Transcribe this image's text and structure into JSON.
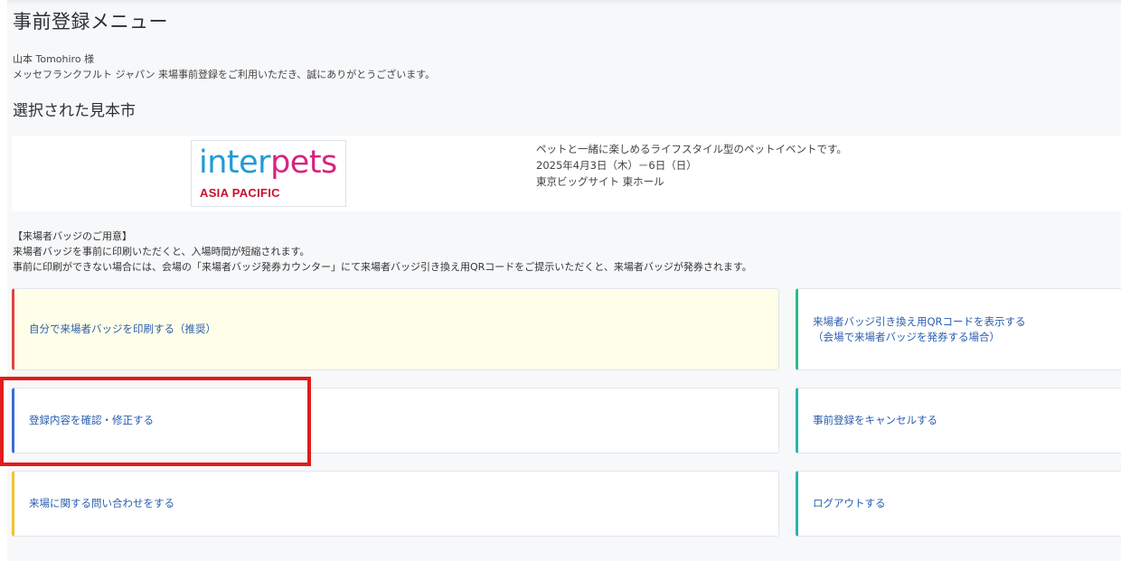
{
  "header": {
    "title": "事前登録メニュー"
  },
  "greeting": {
    "user_line": "山本 Tomohiro 様",
    "message": "メッセフランクフルト ジャパン 来場事前登録をご利用いただき、誠にありがとうございます。"
  },
  "selected_fair": {
    "section_title": "選択された見本市",
    "logo_text_part1": "inter",
    "logo_text_part2": "pets",
    "logo_subtitle": "ASIA PACIFIC",
    "description": "ペットと一緒に楽しめるライフスタイル型のペットイベントです。",
    "dates": "2025年4月3日（木）－6日（日）",
    "venue": "東京ビッグサイト 東ホール"
  },
  "badge_notice": {
    "heading": "【来場者バッジのご用意】",
    "line1": "来場者バッジを事前に印刷いただくと、入場時間が短縮されます。",
    "line2": "事前に印刷ができない場合には、会場の「来場者バッジ発券カウンター」にて来場者バッジ引き換え用QRコードをご提示いただくと、来場者バッジが発券されます。"
  },
  "menu": {
    "print_badge": "自分で来場者バッジを印刷する（推奨）",
    "show_qr_line1": "来場者バッジ引き換え用QRコードを表示する",
    "show_qr_line2": "（会場で来場者バッジを発券する場合）",
    "confirm_edit": "登録内容を確認・修正する",
    "cancel_registration": "事前登録をキャンセルする",
    "contact": "来場に関する問い合わせをする",
    "logout": "ログアウトする"
  },
  "colors": {
    "print_accent": "#e04545",
    "qr_accent": "#2fb98a",
    "confirm_accent": "#3a6ed8",
    "cancel_accent": "#2bb3ad",
    "contact_accent": "#f2c230",
    "logout_accent": "#2bb3ad",
    "highlight": "#e21b1b",
    "logo_inter": "#1e9bd7",
    "logo_pets": "#d6247f"
  }
}
